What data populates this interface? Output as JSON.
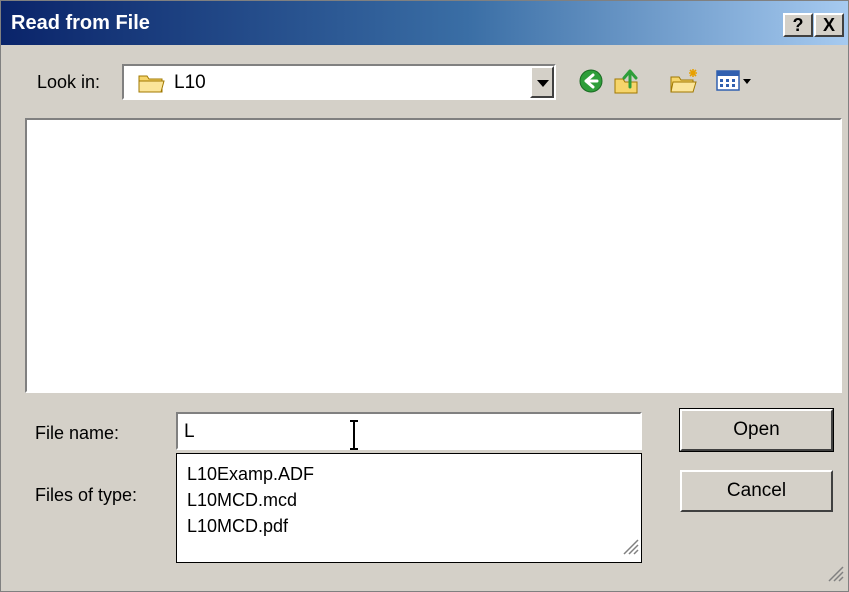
{
  "dialog": {
    "title": "Read from File",
    "help_button": "?",
    "close_button": "X"
  },
  "lookin": {
    "label": "Look in:",
    "value": "L10",
    "icon": "folder-icon"
  },
  "toolbar": {
    "icons": [
      "back-icon",
      "up-folder-icon",
      "new-folder-icon",
      "view-menu-icon"
    ]
  },
  "file_list": {
    "items": []
  },
  "filename": {
    "label": "File name:",
    "value": "L"
  },
  "filetype": {
    "label": "Files of type:"
  },
  "autocomplete": {
    "items": [
      "L10Examp.ADF",
      "L10MCD.mcd",
      "L10MCD.pdf"
    ]
  },
  "buttons": {
    "open": "Open",
    "cancel": "Cancel"
  },
  "colors": {
    "title_start": "#0a246a",
    "title_end": "#a6caf0",
    "face": "#d4d0c8"
  }
}
